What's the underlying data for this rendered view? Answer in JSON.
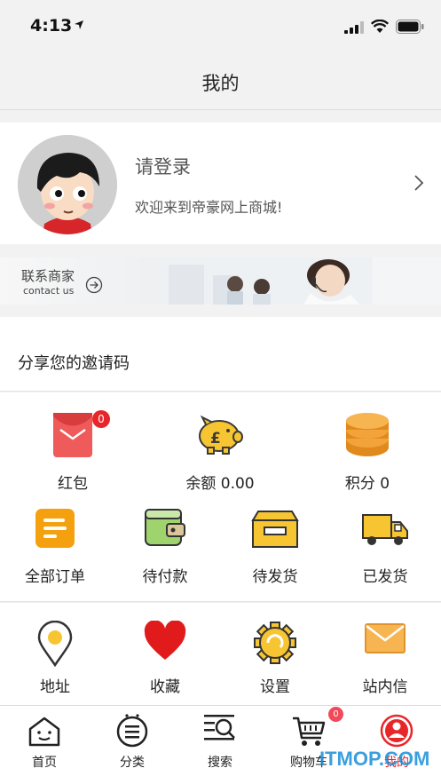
{
  "status": {
    "time": "4:13"
  },
  "nav": {
    "title": "我的"
  },
  "profile": {
    "login": "请登录",
    "welcome": "欢迎来到帝豪网上商城!"
  },
  "banner": {
    "title": "联系商家",
    "subtitle": "contact us"
  },
  "share": {
    "title": "分享您的邀请码"
  },
  "wallet": [
    {
      "label": "红包",
      "icon": "red-envelope-icon",
      "badge": "0"
    },
    {
      "label": "余额 0.00",
      "icon": "piggy-bank-icon"
    },
    {
      "label": "积分 0",
      "icon": "coin-stack-icon"
    }
  ],
  "orders": [
    {
      "label": "全部订单",
      "icon": "order-list-icon"
    },
    {
      "label": "待付款",
      "icon": "wallet-icon"
    },
    {
      "label": "待发货",
      "icon": "package-box-icon"
    },
    {
      "label": "已发货",
      "icon": "delivery-truck-icon"
    }
  ],
  "services": [
    {
      "label": "地址",
      "icon": "location-pin-icon"
    },
    {
      "label": "收藏",
      "icon": "heart-icon"
    },
    {
      "label": "设置",
      "icon": "gear-icon"
    },
    {
      "label": "站内信",
      "icon": "mail-envelope-icon"
    }
  ],
  "tabbar": [
    {
      "label": "首页",
      "icon": "home-icon"
    },
    {
      "label": "分类",
      "icon": "category-icon"
    },
    {
      "label": "搜索",
      "icon": "search-icon"
    },
    {
      "label": "购物车",
      "icon": "cart-icon",
      "badge": "0"
    },
    {
      "label": "我的",
      "icon": "user-profile-icon",
      "active": true
    }
  ],
  "watermark": "ITMOP.COM",
  "colors": {
    "accent": "#e8262a",
    "orange": "#f5a623",
    "yellow": "#f7c531",
    "background": "#f2f2f2"
  }
}
